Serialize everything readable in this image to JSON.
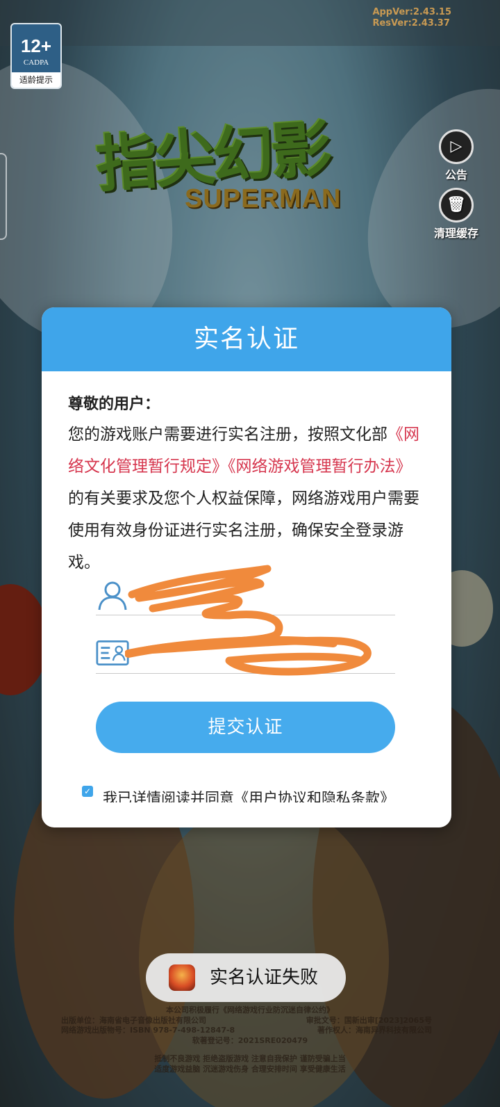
{
  "version": {
    "app": "AppVer:2.43.15",
    "res": "ResVer:2.43.37"
  },
  "age_badge": {
    "rating": "12+",
    "org": "CADPA",
    "tip": "适龄提示"
  },
  "logo": {
    "title_cn": "指尖幻影",
    "title_en": "SUPERMAN"
  },
  "side_buttons": {
    "announcement": "公告",
    "clear_cache": "清理缓存"
  },
  "modal": {
    "title": "实名认证",
    "greeting": "尊敬的用户：",
    "notice_prefix": "您的游戏账户需要进行实名注册，按照文化部",
    "link1": "《网络文化管理暂行规定》",
    "link2": "《网络游戏管理暂行办法》",
    "notice_suffix": "的有关要求及您个人权益保障，网络游戏用户需要使用有效身份证进行实名注册，确保安全登录游戏。",
    "name_field": {
      "value": "",
      "placeholder": ""
    },
    "id_field": {
      "value": "",
      "placeholder": ""
    },
    "submit_label": "提交认证",
    "agree_text": "我已详情阅读并同意《用户协议和隐私条款》"
  },
  "toast": {
    "message": "实名认证失败"
  },
  "footer": {
    "line1": "本公司积极履行《网络游戏行业防沉迷自律公约》",
    "publisher": "出版单位：海南省电子音像出版社有限公司",
    "approval": "审批文号：国新出审[2023]2065号",
    "isbn": "网络游戏出版物号：ISBN 978-7-498-12847-8",
    "copyright_owner": "著作权人：海南异界科技有限公司",
    "software_reg": "软著登记号：2021SRE020479",
    "health1": "抵制不良游戏 拒绝盗版游戏 注意自我保护 谨防受骗上当",
    "health2": "适度游戏益脑 沉迷游戏伤身 合理安排时间 享受健康生活"
  },
  "colors": {
    "accent": "#3fa5ea",
    "link": "#d6364e",
    "scribble": "#f08a3c"
  }
}
